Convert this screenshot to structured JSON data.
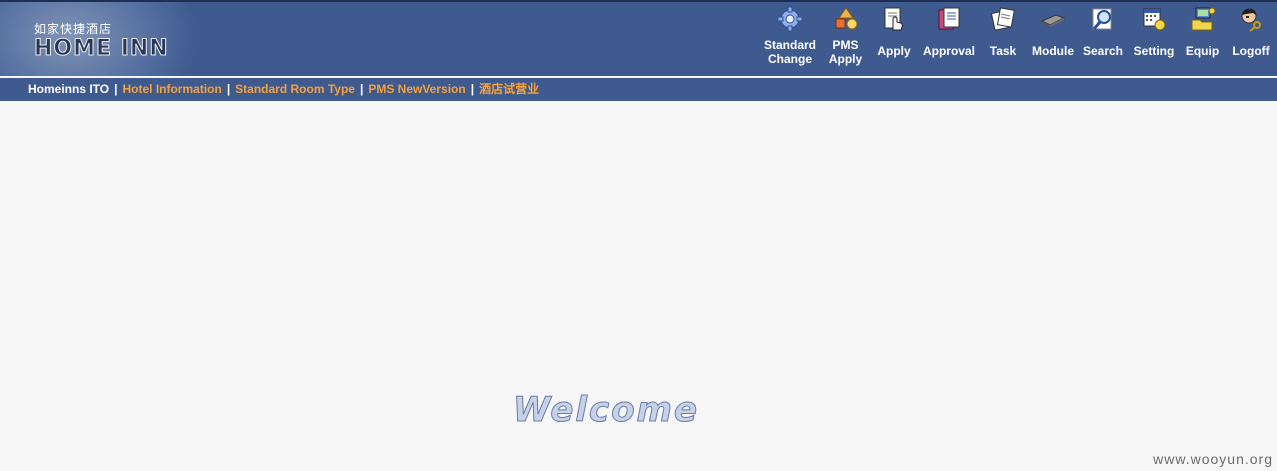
{
  "header": {
    "logo_cn": "如家快捷酒店",
    "logo_en": "HOME INN",
    "toolbar": [
      {
        "name": "standard-change",
        "label_1": "Standard",
        "label_2": "Change",
        "icon": "gear-icon"
      },
      {
        "name": "pms-apply",
        "label_1": "PMS",
        "label_2": "Apply",
        "icon": "shapes-icon"
      },
      {
        "name": "apply",
        "label_1": "Apply",
        "label_2": "",
        "icon": "hand-document-icon"
      },
      {
        "name": "approval",
        "label_1": "Approval",
        "label_2": "",
        "icon": "approval-document-icon"
      },
      {
        "name": "task",
        "label_1": "Task",
        "label_2": "",
        "icon": "task-pages-icon"
      },
      {
        "name": "module",
        "label_1": "Module",
        "label_2": "",
        "icon": "chip-icon"
      },
      {
        "name": "search",
        "label_1": "Search",
        "label_2": "",
        "icon": "magnifier-icon"
      },
      {
        "name": "setting",
        "label_1": "Setting",
        "label_2": "",
        "icon": "settings-calendar-icon"
      },
      {
        "name": "equip",
        "label_1": "Equip",
        "label_2": "",
        "icon": "computer-folder-icon"
      },
      {
        "name": "logoff",
        "label_1": "Logoff",
        "label_2": "",
        "icon": "user-key-icon"
      }
    ]
  },
  "nav": {
    "home": "Homeinns ITO",
    "separator": "|",
    "links": [
      "Hotel Information",
      "Standard Room Type",
      "PMS NewVersion",
      "酒店试营业"
    ]
  },
  "main": {
    "welcome": "Welcome"
  },
  "watermark": "www.wooyun.org",
  "colors": {
    "header_bg": "#3e5a8e",
    "nav_link": "#f7a13a",
    "page_bg": "#f6f6f6"
  }
}
